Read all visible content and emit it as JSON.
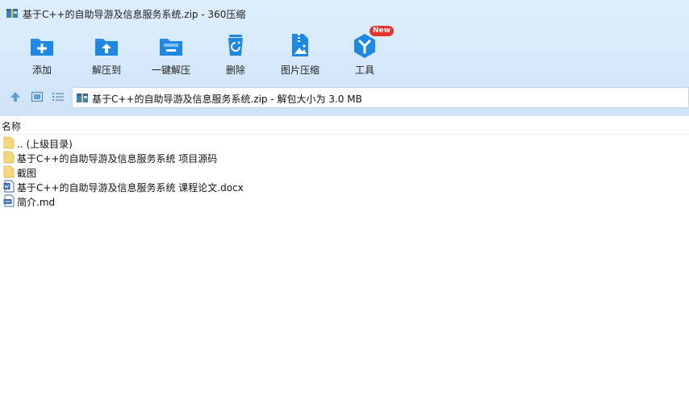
{
  "window": {
    "title": "基于C++的自助导游及信息服务系统.zip - 360压缩"
  },
  "toolbar": {
    "add": "添加",
    "extract_to": "解压到",
    "one_click_extract": "一键解压",
    "delete": "删除",
    "image_compress": "图片压缩",
    "tools": "工具",
    "tools_badge": "New"
  },
  "address": {
    "path": "基于C++的自助导游及信息服务系统.zip - 解包大小为 3.0 MB"
  },
  "list": {
    "header_name": "名称",
    "rows": [
      {
        "name": ".. (上级目录)",
        "icon": "folder-icon"
      },
      {
        "name": "基于C++的自助导游及信息服务系统 项目源码",
        "icon": "folder-icon"
      },
      {
        "name": "截图",
        "icon": "folder-icon"
      },
      {
        "name": "基于C++的自助导游及信息服务系统 课程论文.docx",
        "icon": "word-doc-icon"
      },
      {
        "name": "简介.md",
        "icon": "md-file-icon"
      }
    ]
  },
  "colors": {
    "accent": "#1e88e5",
    "toolbar_bg": "#d5e8fb",
    "badge": "#e8322c"
  }
}
